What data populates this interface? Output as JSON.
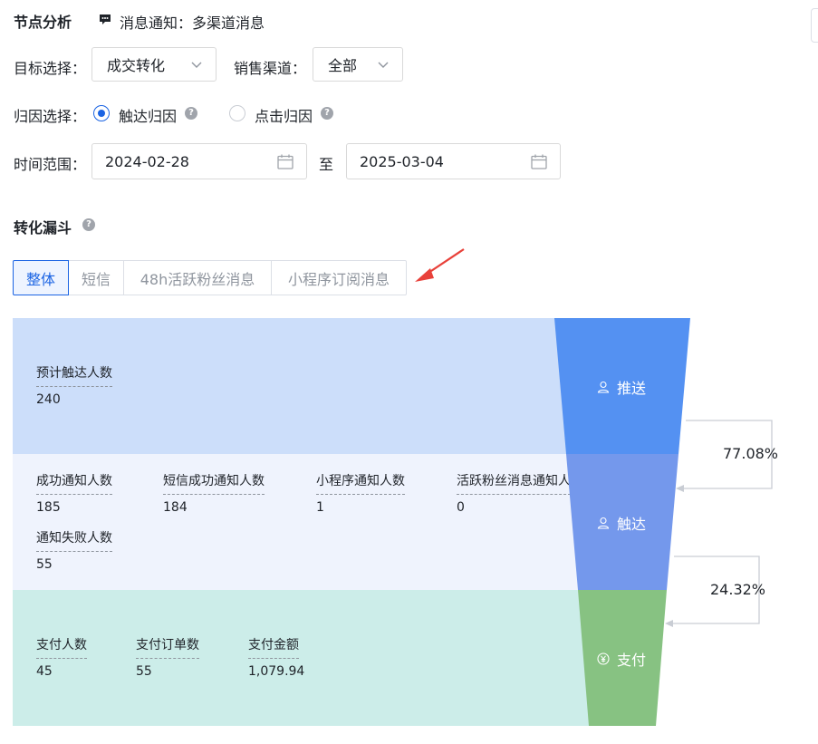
{
  "header": {
    "title": "节点分析",
    "message_icon": "message-icon",
    "message_text": "消息通知：多渠道消息"
  },
  "filters": {
    "target_label": "目标选择：",
    "target_value": "成交转化",
    "channel_label": "销售渠道：",
    "channel_value": "全部",
    "attribution_label": "归因选择：",
    "attribution_options": [
      {
        "label": "触达归因",
        "selected": true
      },
      {
        "label": "点击归因",
        "selected": false
      }
    ],
    "time_label": "时间范围：",
    "date_start": "2024-02-28",
    "date_sep": "至",
    "date_end": "2025-03-04"
  },
  "funnel": {
    "section_title": "转化漏斗",
    "tabs": [
      {
        "label": "整体",
        "active": true
      },
      {
        "label": "短信",
        "active": false
      },
      {
        "label": "48h活跃粉丝消息",
        "active": false
      },
      {
        "label": "小程序订阅消息",
        "active": false
      }
    ],
    "stages": [
      {
        "name": "推送",
        "icon": "user-icon",
        "color": "#5491f2",
        "band_color": "#ccdefa"
      },
      {
        "name": "触达",
        "icon": "user-icon",
        "color": "#7498ec",
        "band_color": "#eff3fd"
      },
      {
        "name": "支付",
        "icon": "yuan-icon",
        "color": "#87c282",
        "band_color": "#ccede9"
      }
    ],
    "rates": [
      "77.08%",
      "24.32%"
    ],
    "push_metrics": [
      {
        "label": "预计触达人数",
        "value": "240"
      }
    ],
    "reach_metrics": [
      {
        "label": "成功通知人数",
        "value": "185"
      },
      {
        "label": "短信成功通知人数",
        "value": "184"
      },
      {
        "label": "小程序通知人数",
        "value": "1"
      },
      {
        "label": "活跃粉丝消息通知人",
        "value": "0"
      },
      {
        "label": "通知失败人数",
        "value": "55"
      }
    ],
    "pay_metrics": [
      {
        "label": "支付人数",
        "value": "45"
      },
      {
        "label": "支付订单数",
        "value": "55"
      },
      {
        "label": "支付金额",
        "value": "1,079.94"
      }
    ]
  },
  "colors": {
    "accent": "#1b64e3",
    "annotation_arrow": "#e8413a"
  }
}
